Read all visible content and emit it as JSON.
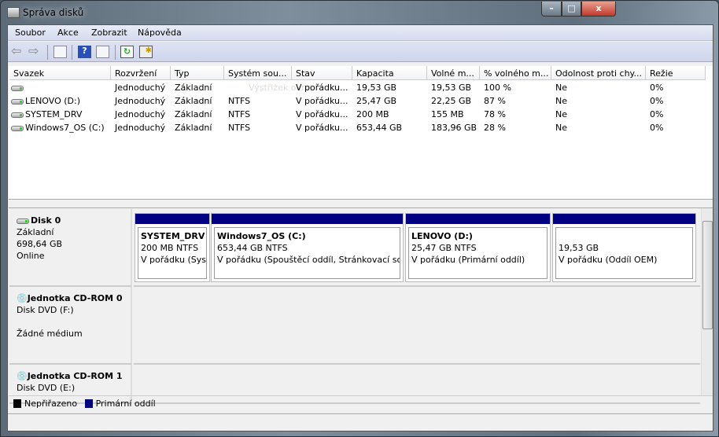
{
  "window": {
    "title": "Správa disků",
    "minimize": "–",
    "maximize": "□",
    "close": "x"
  },
  "menu": [
    "Soubor",
    "Akce",
    "Zobrazit",
    "Nápověda"
  ],
  "toolbar": [
    "back-icon",
    "forward-icon",
    "console-tree-icon",
    "help-icon",
    "action-pane-icon",
    "refresh-icon",
    "properties-icon"
  ],
  "table": {
    "columns": [
      "Svazek",
      "Rozvržení",
      "Typ",
      "Systém sou...",
      "Stav",
      "Kapacita",
      "Volné m...",
      "% volného m...",
      "Odolnost proti chy...",
      "Režie"
    ],
    "rows": [
      [
        "",
        "Jednoduchý",
        "Základní",
        "",
        "V pořádku...",
        "19,53 GB",
        "19,53 GB",
        "100 %",
        "Ne",
        "0%"
      ],
      [
        "LENOVO (D:)",
        "Jednoduchý",
        "Základní",
        "NTFS",
        "V pořádku...",
        "25,47 GB",
        "22,25 GB",
        "87 %",
        "Ne",
        "0%"
      ],
      [
        "SYSTEM_DRV",
        "Jednoduchý",
        "Základní",
        "NTFS",
        "V pořádku...",
        "200 MB",
        "155 MB",
        "78 %",
        "Ne",
        "0%"
      ],
      [
        "Windows7_OS (C:)",
        "Jednoduchý",
        "Základní",
        "NTFS",
        "V pořádku...",
        "653,44 GB",
        "183,96 GB",
        "28 %",
        "Ne",
        "0%"
      ]
    ],
    "tooltip": "Výstřižek okna"
  },
  "disks": [
    {
      "name": "Disk 0",
      "type": "Základní",
      "size": "698,64 GB",
      "status": "Online",
      "partitions": [
        {
          "name": "SYSTEM_DRV",
          "size": "200 MB NTFS",
          "status": "V pořádku (Syst"
        },
        {
          "name": "Windows7_OS  (C:)",
          "size": "653,44 GB NTFS",
          "status": "V pořádku (Spouštěcí oddíl, Stránkovací sou"
        },
        {
          "name": "LENOVO  (D:)",
          "size": "25,47 GB NTFS",
          "status": "V pořádku (Primární oddíl)"
        },
        {
          "name": "",
          "size": "19,53 GB",
          "status": "V pořádku (Oddíl OEM)"
        }
      ]
    },
    {
      "name": "Jednotka CD-ROM 0",
      "type": "Disk DVD (F:)",
      "status": "Žádné médium"
    },
    {
      "name": "Jednotka CD-ROM 1",
      "type": "Disk DVD (E:)"
    }
  ],
  "legend": [
    {
      "label": "Nepřiřazeno",
      "color": "#000000"
    },
    {
      "label": "Primární oddíl",
      "color": "#000080"
    }
  ]
}
